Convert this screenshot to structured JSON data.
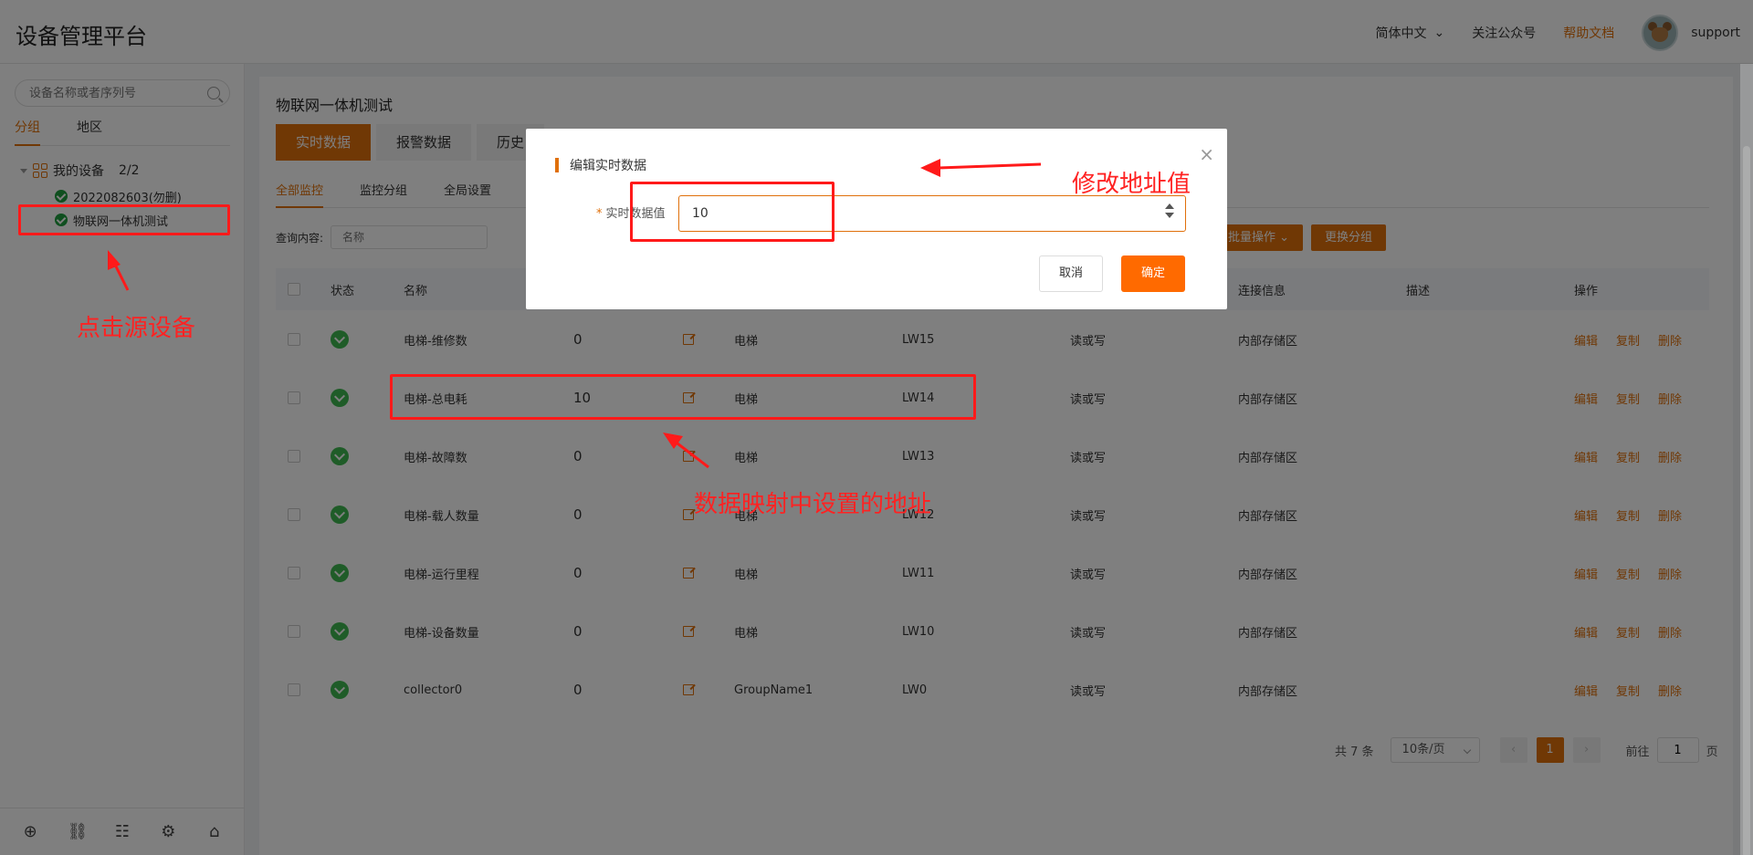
{
  "header": {
    "app_title": "设备管理平台",
    "lang": "简体中文",
    "follow": "关注公众号",
    "help": "帮助文档",
    "user": "support"
  },
  "sidebar": {
    "search_placeholder": "设备名称或者序列号",
    "tabs": [
      "分组",
      "地区"
    ],
    "tree_root": "我的设备",
    "tree_count": "2/2",
    "devices": [
      "2022082603(勿删)",
      "物联网一体机测试"
    ]
  },
  "main": {
    "device_title": "物联网一体机测试",
    "top_tabs": [
      "实时数据",
      "报警数据",
      "历史"
    ],
    "sub_tabs": [
      "全部监控",
      "监控分组",
      "全局设置"
    ],
    "query_label": "查询内容:",
    "query_placeholder": "名称",
    "batch_label": "批量操作",
    "move_label": "更换分组",
    "columns": {
      "status": "状态",
      "name": "名称",
      "conn": "连接信息",
      "desc": "描述",
      "op": "操作"
    },
    "rows": [
      {
        "name": "电梯-维修数",
        "value": "0",
        "group": "电梯",
        "addr": "LW15",
        "rw": "读或写",
        "conn": "内部存储区"
      },
      {
        "name": "电梯-总电耗",
        "value": "10",
        "group": "电梯",
        "addr": "LW14",
        "rw": "读或写",
        "conn": "内部存储区"
      },
      {
        "name": "电梯-故障数",
        "value": "0",
        "group": "电梯",
        "addr": "LW13",
        "rw": "读或写",
        "conn": "内部存储区"
      },
      {
        "name": "电梯-载人数量",
        "value": "0",
        "group": "电梯",
        "addr": "LW12",
        "rw": "读或写",
        "conn": "内部存储区"
      },
      {
        "name": "电梯-运行里程",
        "value": "0",
        "group": "电梯",
        "addr": "LW11",
        "rw": "读或写",
        "conn": "内部存储区"
      },
      {
        "name": "电梯-设备数量",
        "value": "0",
        "group": "电梯",
        "addr": "LW10",
        "rw": "读或写",
        "conn": "内部存储区"
      },
      {
        "name": "collector0",
        "value": "0",
        "group": "GroupName1",
        "addr": "LW0",
        "rw": "读或写",
        "conn": "内部存储区"
      }
    ],
    "ops": {
      "edit": "编辑",
      "copy": "复制",
      "delete": "删除"
    },
    "pager": {
      "total": "共 7 条",
      "page_size": "10条/页",
      "prev": "‹",
      "current": "1",
      "next": "›",
      "goto_prefix": "前往",
      "goto_value": "1",
      "goto_suffix": "页"
    }
  },
  "dialog": {
    "title": "编辑实时数据",
    "close": "×",
    "required_mark": "*",
    "field_label": "实时数据值",
    "field_value": "10",
    "cancel": "取消",
    "confirm": "确定"
  },
  "annotations": {
    "click_source": "点击源设备",
    "modify_value": "修改地址值",
    "mapping_addr": "数据映射中设置的地址"
  },
  "colors": {
    "accent": "#e0700b",
    "confirm": "#ff6a00",
    "annotation": "#ff1a1a",
    "status_ok": "#3fb951"
  }
}
